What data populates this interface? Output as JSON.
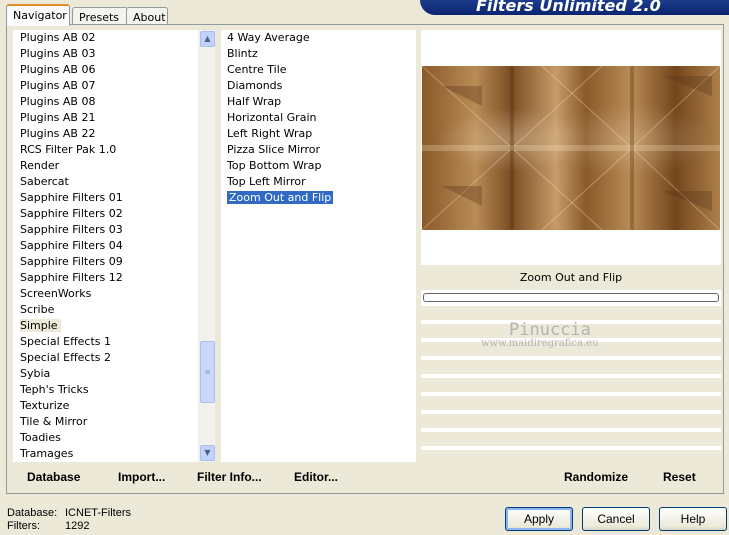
{
  "tabs": [
    {
      "label": "Navigator",
      "active": true
    },
    {
      "label": "Presets",
      "active": false
    },
    {
      "label": "About",
      "active": false
    }
  ],
  "banner_title": "Filters Unlimited 2.0",
  "categories": [
    "Plugins AB 02",
    "Plugins AB 03",
    "Plugins AB 06",
    "Plugins AB 07",
    "Plugins AB 08",
    "Plugins AB 21",
    "Plugins AB 22",
    "RCS Filter Pak 1.0",
    "Render",
    "Sabercat",
    "Sapphire Filters 01",
    "Sapphire Filters 02",
    "Sapphire Filters 03",
    "Sapphire Filters 04",
    "Sapphire Filters 09",
    "Sapphire Filters 12",
    "ScreenWorks",
    "Scribe",
    "Simple",
    "Special Effects 1",
    "Special Effects 2",
    "Sybia",
    "Teph's Tricks",
    "Texturize",
    "Tile & Mirror",
    "Toadies",
    "Tramages"
  ],
  "current_category": "Simple",
  "filters": [
    "4 Way Average",
    "Blintz",
    "Centre Tile",
    "Diamonds",
    "Half Wrap",
    "Horizontal Grain",
    "Left Right Wrap",
    "Pizza Slice Mirror",
    "Top Bottom Wrap",
    "Top Left Mirror",
    "Zoom Out and Flip"
  ],
  "selected_filter": "Zoom Out and Flip",
  "preview_caption": "Zoom Out and Flip",
  "watermark": {
    "name": "Pinuccia",
    "url": "www.maidiregrafica.eu"
  },
  "left_buttons": {
    "database": "Database",
    "import": "Import...",
    "filter_info": "Filter Info...",
    "editor": "Editor..."
  },
  "right_buttons": {
    "randomize": "Randomize",
    "reset": "Reset"
  },
  "status": {
    "database_label": "Database:",
    "database_value": "ICNET-Filters",
    "filters_label": "Filters:",
    "filters_value": "1292"
  },
  "dialog_buttons": {
    "apply": "Apply",
    "cancel": "Cancel",
    "help": "Help"
  },
  "icons": {
    "scroll_up": "arrow-up-icon",
    "scroll_down": "arrow-down-icon",
    "thumb_grip": "grip-icon"
  },
  "colors": {
    "selection": "#316ac5",
    "banner": "#0b2471",
    "tab_highlight": "#e68b2c"
  }
}
